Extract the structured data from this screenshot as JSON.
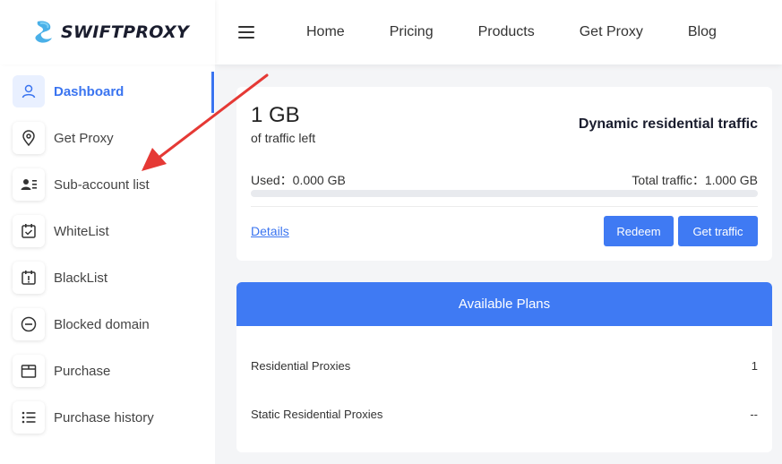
{
  "brand": {
    "name": "SWIFTPROXY",
    "accent": "#3a74f0"
  },
  "nav": {
    "items": [
      "Home",
      "Pricing",
      "Products",
      "Get Proxy",
      "Blog"
    ]
  },
  "sidebar": {
    "items": [
      {
        "label": "Dashboard",
        "icon": "user-icon",
        "active": true
      },
      {
        "label": "Get Proxy",
        "icon": "location-pin-icon"
      },
      {
        "label": "Sub-account list",
        "icon": "contact-list-icon"
      },
      {
        "label": "WhiteList",
        "icon": "calendar-check-icon"
      },
      {
        "label": "BlackList",
        "icon": "calendar-alert-icon"
      },
      {
        "label": "Blocked domain",
        "icon": "minus-circle-icon"
      },
      {
        "label": "Purchase",
        "icon": "box-icon"
      },
      {
        "label": "Purchase history",
        "icon": "list-icon"
      }
    ]
  },
  "traffic": {
    "remaining": "1 GB",
    "remaining_caption": "of traffic left",
    "title": "Dynamic residential traffic",
    "used_label": "Used：0.000 GB",
    "total_label": "Total traffic：1.000 GB",
    "used_fraction": 0,
    "details_label": "Details",
    "redeem_label": "Redeem",
    "get_traffic_label": "Get traffic"
  },
  "plans": {
    "header": "Available Plans",
    "rows": [
      {
        "name": "Residential Proxies",
        "value": "1"
      },
      {
        "name": "Static Residential Proxies",
        "value": "--"
      }
    ]
  },
  "annotation": {
    "color": "#e53935"
  }
}
